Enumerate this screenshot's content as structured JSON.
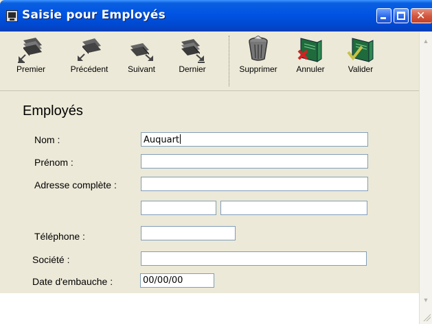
{
  "window": {
    "title": "Saisie pour  Employés"
  },
  "toolbar": {
    "items": [
      {
        "label": "Premier",
        "icon": "first-record-icon"
      },
      {
        "label": "Précédent",
        "icon": "previous-record-icon"
      },
      {
        "label": "Suivant",
        "icon": "next-record-icon"
      },
      {
        "label": "Dernier",
        "icon": "last-record-icon"
      },
      {
        "label": "Supprimer",
        "icon": "trash-bin-icon"
      },
      {
        "label": "Annuler",
        "icon": "cancel-folder-icon"
      },
      {
        "label": "Valider",
        "icon": "validate-folder-icon"
      }
    ]
  },
  "form": {
    "title": "Employés",
    "labels": {
      "nom": "Nom :",
      "prenom": "Prénom :",
      "adresse": "Adresse complète :",
      "telephone": "Téléphone :",
      "societe": "Société :",
      "date_embauche": "Date d'embauche :"
    },
    "values": {
      "nom": "Auquart",
      "prenom": "",
      "adresse": "",
      "code_postal": "",
      "ville": "",
      "telephone": "",
      "societe": "",
      "date_embauche": "00/00/00"
    }
  }
}
